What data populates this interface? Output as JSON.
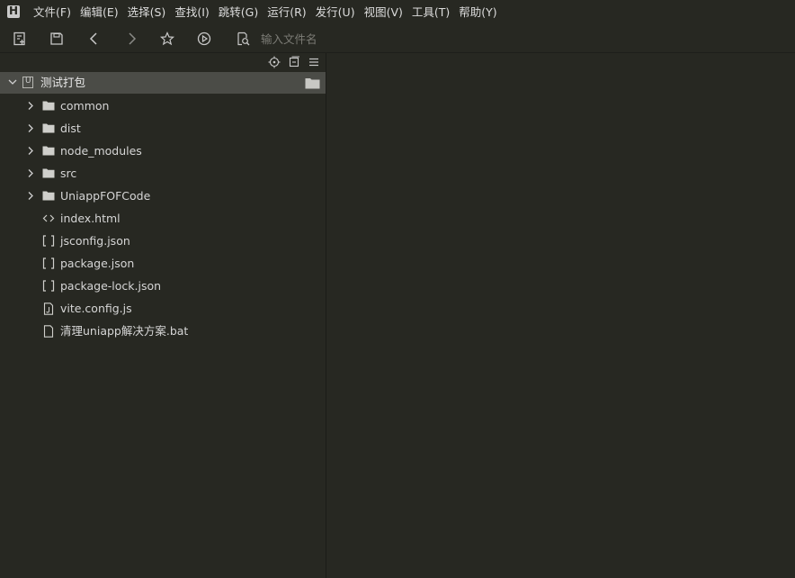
{
  "menu": [
    "文件(F)",
    "编辑(E)",
    "选择(S)",
    "查找(I)",
    "跳转(G)",
    "运行(R)",
    "发行(U)",
    "视图(V)",
    "工具(T)",
    "帮助(Y)"
  ],
  "search": {
    "placeholder": "输入文件名"
  },
  "project": {
    "name": "测试打包"
  },
  "tree": [
    {
      "label": "common",
      "type": "folder"
    },
    {
      "label": "dist",
      "type": "folder"
    },
    {
      "label": "node_modules",
      "type": "folder"
    },
    {
      "label": "src",
      "type": "folder"
    },
    {
      "label": "UniappFOFCode",
      "type": "folder"
    },
    {
      "label": "index.html",
      "type": "html"
    },
    {
      "label": "jsconfig.json",
      "type": "json"
    },
    {
      "label": "package.json",
      "type": "json"
    },
    {
      "label": "package-lock.json",
      "type": "json"
    },
    {
      "label": "vite.config.js",
      "type": "js"
    },
    {
      "label": "清理uniapp解决方案.bat",
      "type": "file"
    }
  ]
}
